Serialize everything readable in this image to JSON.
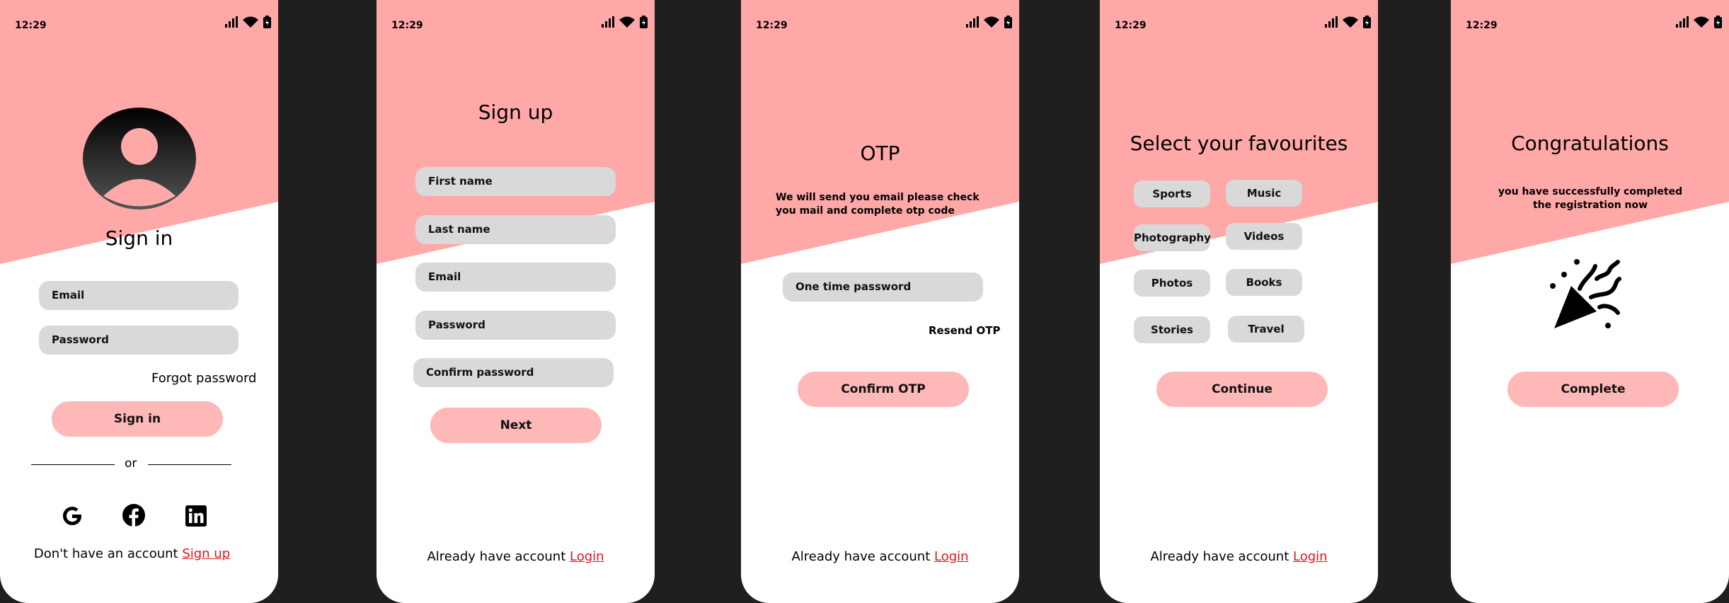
{
  "status": {
    "time": "12:29"
  },
  "colors": {
    "pink": "#ffa8a8",
    "button_pink": "#ffb8b8",
    "field_gray": "#d9d9d9",
    "link_red": "#e0151b",
    "backdrop": "#1f1f1f"
  },
  "signin": {
    "avatar_icon": "user-avatar-icon",
    "title": "Sign in",
    "email_placeholder": "Email",
    "password_placeholder": "Password",
    "forgot": "Forgot password",
    "button": "Sign in",
    "divider": "or",
    "social_icons": [
      "google-icon",
      "facebook-icon",
      "linkedin-icon"
    ],
    "footer_text": "Don't have an account ",
    "footer_link": "Sign up"
  },
  "signup": {
    "title": "Sign up",
    "fields": [
      "First name",
      "Last name",
      "Email",
      "Password",
      "Confirm password"
    ],
    "button": "Next",
    "footer_text": "Already have account ",
    "footer_link": "Login"
  },
  "otp": {
    "title": "OTP",
    "description": "We will send you email please check you mail and complete otp code",
    "otp_placeholder": "One time password",
    "resend": "Resend OTP",
    "button": "Confirm OTP",
    "footer_text": "Already have account ",
    "footer_link": "Login"
  },
  "favourites": {
    "title": "Select your favourites",
    "chips": [
      "Sports",
      "Music",
      "Photography",
      "Videos",
      "Photos",
      "Books",
      "Stories",
      "Travel"
    ],
    "button": "Continue",
    "footer_text": "Already have account ",
    "footer_link": "Login"
  },
  "congrats": {
    "title": "Congratulations",
    "description": "you have successfully completed the registration now",
    "icon": "party-popper-icon",
    "button": "Complete"
  }
}
